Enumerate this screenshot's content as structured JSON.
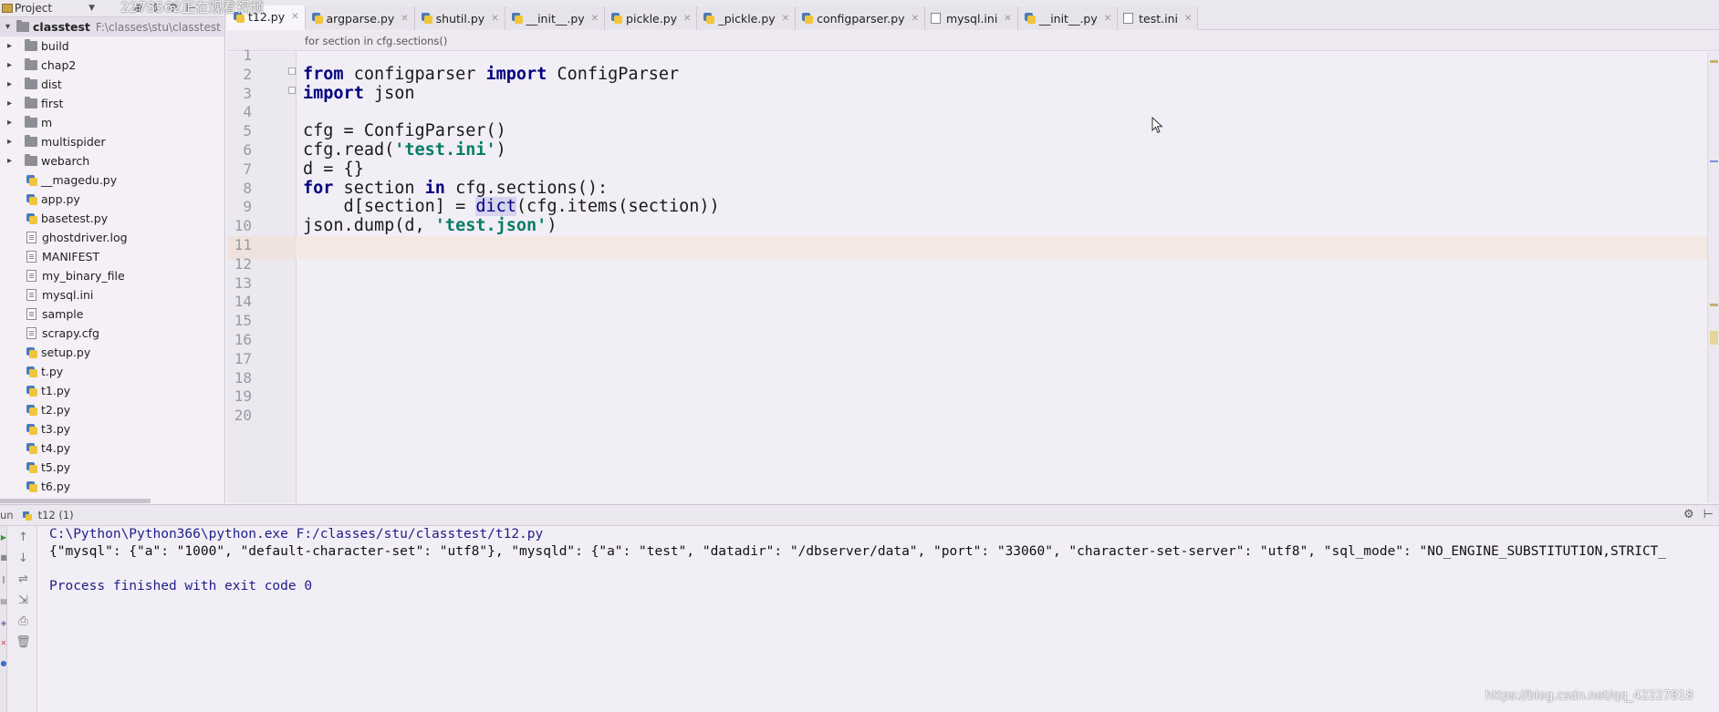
{
  "watermark_top": "2278562正在观看视频",
  "project_panel": {
    "header_label": "Project",
    "root": {
      "name": "classtest",
      "path": "F:\\classes\\stu\\classtest"
    },
    "folders": [
      "build",
      "chap2",
      "dist",
      "first",
      "m",
      "multispider",
      "webarch"
    ],
    "files": [
      {
        "name": "__magedu.py",
        "icon": "python-file-icon"
      },
      {
        "name": "app.py",
        "icon": "python-file-icon"
      },
      {
        "name": "basetest.py",
        "icon": "python-file-icon"
      },
      {
        "name": "ghostdriver.log",
        "icon": "text-file-icon"
      },
      {
        "name": "MANIFEST",
        "icon": "text-file-icon"
      },
      {
        "name": "my_binary_file",
        "icon": "text-file-icon"
      },
      {
        "name": "mysql.ini",
        "icon": "text-file-icon"
      },
      {
        "name": "sample",
        "icon": "text-file-icon"
      },
      {
        "name": "scrapy.cfg",
        "icon": "text-file-icon"
      },
      {
        "name": "setup.py",
        "icon": "python-file-icon"
      },
      {
        "name": "t.py",
        "icon": "python-file-icon"
      },
      {
        "name": "t1.py",
        "icon": "python-file-icon"
      },
      {
        "name": "t2.py",
        "icon": "python-file-icon"
      },
      {
        "name": "t3.py",
        "icon": "python-file-icon"
      },
      {
        "name": "t4.py",
        "icon": "python-file-icon"
      },
      {
        "name": "t5.py",
        "icon": "python-file-icon"
      },
      {
        "name": "t6.py",
        "icon": "python-file-icon"
      }
    ]
  },
  "editor": {
    "tabs": [
      {
        "label": "t12.py",
        "active": true,
        "icon": "python-file-icon",
        "closable": true
      },
      {
        "label": "argparse.py",
        "active": false,
        "icon": "python-file-icon",
        "closable": true
      },
      {
        "label": "shutil.py",
        "active": false,
        "icon": "python-file-icon",
        "closable": true
      },
      {
        "label": "__init__.py",
        "active": false,
        "icon": "python-file-icon",
        "closable": true
      },
      {
        "label": "pickle.py",
        "active": false,
        "icon": "python-file-icon",
        "closable": true
      },
      {
        "label": "_pickle.py",
        "active": false,
        "icon": "python-file-icon",
        "closable": true
      },
      {
        "label": "configparser.py",
        "active": false,
        "icon": "python-file-icon",
        "closable": true
      },
      {
        "label": "mysql.ini",
        "active": false,
        "icon": "ini-file-icon",
        "closable": true
      },
      {
        "label": "__init__.py",
        "active": false,
        "icon": "python-file-icon",
        "closable": true
      },
      {
        "label": "test.ini",
        "active": false,
        "icon": "ini-file-icon",
        "closable": true
      }
    ],
    "breadcrumb": "for section in cfg.sections()",
    "line_numbers": [
      "1",
      "2",
      "3",
      "4",
      "5",
      "6",
      "7",
      "8",
      "9",
      "10",
      "11",
      "12",
      "13",
      "14",
      "15",
      "16",
      "17",
      "18",
      "19",
      "20"
    ],
    "current_line": 9,
    "code_lines": [
      "",
      "from configparser import ConfigParser",
      "import json",
      "",
      "cfg = ConfigParser()",
      "cfg.read('test.ini')",
      "d = {}",
      "for section in cfg.sections():",
      "    d[section] = dict(cfg.items(section))",
      "json.dump(d, 'test.json')"
    ],
    "colors": {
      "keyword": "#000080",
      "string": "#067d67",
      "current_line_bg": "#f3e8e2"
    }
  },
  "run_panel": {
    "label": "un",
    "tab_title": "t12 (1)",
    "console": {
      "command": "C:\\Python\\Python366\\python.exe F:/classes/stu/classtest/t12.py",
      "output": "{\"mysql\": {\"a\": \"1000\", \"default-character-set\": \"utf8\"}, \"mysqld\": {\"a\": \"test\", \"datadir\": \"/dbserver/data\", \"port\": \"33060\", \"character-set-server\": \"utf8\", \"sql_mode\": \"NO_ENGINE_SUBSTITUTION,STRICT_",
      "exit_message": "Process finished with exit code 0"
    }
  },
  "watermark_bottom": "https://blog.csdn.net/qq_42227818"
}
